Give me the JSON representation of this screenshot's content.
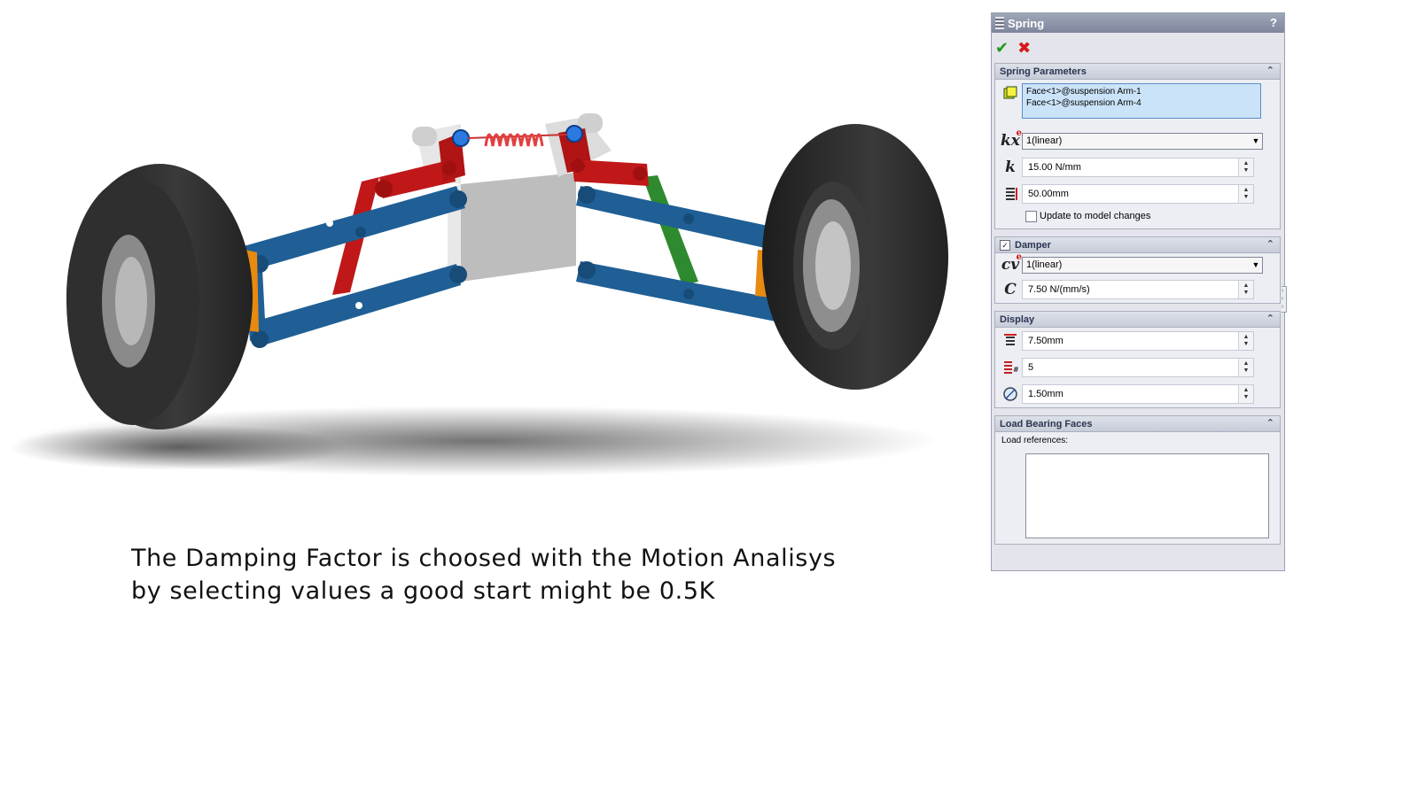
{
  "caption": {
    "line1": "The Damping Factor is choosed with the Motion Analisys",
    "line2": "by selecting values a good start might be 0.5K"
  },
  "panel": {
    "title": "Spring",
    "help": "?",
    "ok_icon": "✔",
    "cancel_icon": "✖",
    "spring_parameters": {
      "title": "Spring Parameters",
      "faces": [
        "Face<1>@suspension Arm-1",
        "Face<1>@suspension Arm-4"
      ],
      "exponent_label": "kx",
      "exponent_sup": "e",
      "exponent_value": "1(linear)",
      "k_label": "k",
      "k_value": "15.00 N/mm",
      "free_length": "50.00mm",
      "update_label": "Update to model changes"
    },
    "damper": {
      "title": "Damper",
      "exponent_label": "cv",
      "exponent_sup": "e",
      "exponent_value": "1(linear)",
      "c_label": "C",
      "c_value": "7.50 N/(mm/s)"
    },
    "display": {
      "title": "Display",
      "coil_diameter": "7.50mm",
      "num_coils": "5",
      "wire_diameter": "1.50mm"
    },
    "load_bearing": {
      "title": "Load Bearing Faces",
      "label": "Load references:"
    }
  },
  "colors": {
    "arm_blue": "#1f5f95",
    "link_red": "#c01818",
    "strut_green": "#2e8a2e",
    "hub_orange": "#e88a10",
    "tire": "#2b2b2b",
    "chassis": "#d8d8d8"
  },
  "icons": [
    "face-selection-icon",
    "free-length-icon",
    "coil-diameter-icon",
    "coil-count-icon",
    "wire-diameter-icon",
    "chevron-up-icon"
  ]
}
